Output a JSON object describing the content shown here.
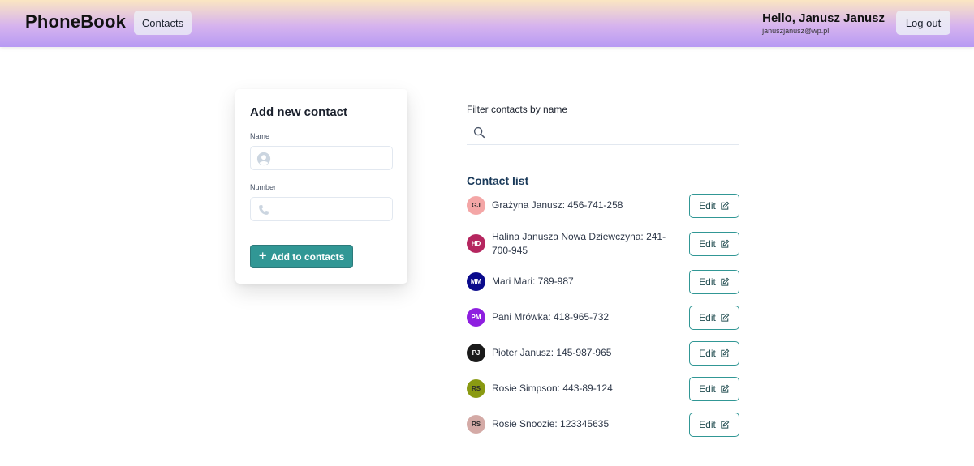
{
  "header": {
    "logo": "PhoneBook",
    "nav_contacts": "Contacts",
    "greeting": "Hello, Janusz Janusz",
    "email": "januszjanusz@wp.pl",
    "logout": "Log out"
  },
  "add_form": {
    "title": "Add new contact",
    "name_label": "Name",
    "name_value": "",
    "number_label": "Number",
    "number_value": "",
    "submit_label": "Add to contacts"
  },
  "filter": {
    "label": "Filter contacts by name",
    "value": ""
  },
  "contacts": {
    "title": "Contact list",
    "edit_label": "Edit",
    "items": [
      {
        "initials": "GJ",
        "text": "Grażyna Janusz: 456-741-258",
        "avatar_bg": "#f4a6a6",
        "avatar_fg": "#2d2d2d"
      },
      {
        "initials": "HD",
        "text": "Halina Janusza Nowa Dziewczyna: 241-700-945",
        "avatar_bg": "#b5265f",
        "avatar_fg": "#ffffff"
      },
      {
        "initials": "MM",
        "text": "Mari Mari: 789-987",
        "avatar_bg": "#0a0a8c",
        "avatar_fg": "#ffffff"
      },
      {
        "initials": "PM",
        "text": "Pani Mrówka: 418-965-732",
        "avatar_bg": "#8e1fe0",
        "avatar_fg": "#ffffff"
      },
      {
        "initials": "PJ",
        "text": "Pioter Janusz: 145-987-965",
        "avatar_bg": "#1a1a1a",
        "avatar_fg": "#ffffff"
      },
      {
        "initials": "RS",
        "text": "Rosie Simpson: 443-89-124",
        "avatar_bg": "#8a9a12",
        "avatar_fg": "#2d2d2d"
      },
      {
        "initials": "RS",
        "text": "Rosie Snoozie: 123345635",
        "avatar_bg": "#d4aaa6",
        "avatar_fg": "#2d2d2d"
      }
    ]
  },
  "icons": {
    "name_field": "user-circle-icon",
    "number_field": "phone-icon",
    "filter": "search-icon",
    "add": "plus-icon",
    "edit": "edit-icon"
  },
  "colors": {
    "accent": "#319795",
    "header_gradient_top": "#fbe6c2",
    "header_gradient_bottom": "#b79af3"
  }
}
